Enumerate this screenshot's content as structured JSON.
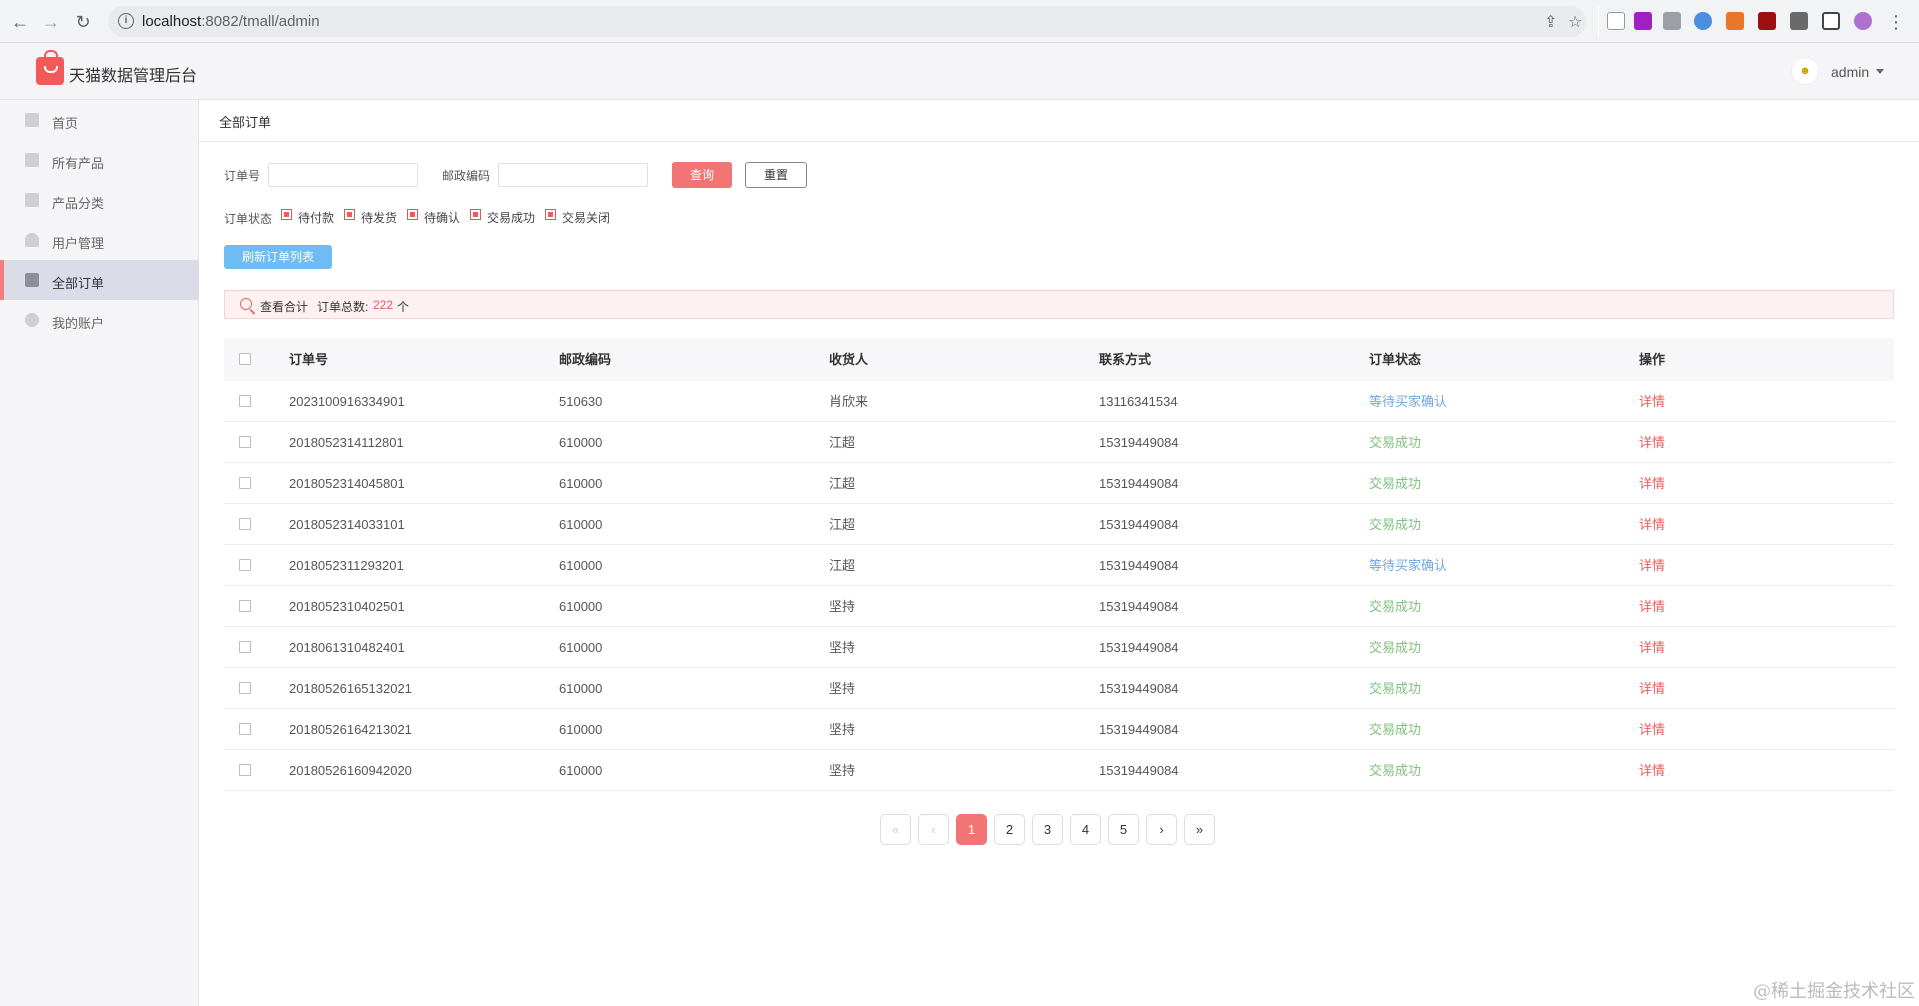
{
  "browser": {
    "back_icon": "back-arrow-icon",
    "forward_icon": "forward-arrow-icon",
    "reload_icon": "reload-icon",
    "url_host": "localhost",
    "url_path": ":8082/tmall/admin"
  },
  "header": {
    "app_title": "天猫数据管理后台",
    "admin_name": "admin"
  },
  "sidebar": {
    "items": [
      {
        "label": "首页",
        "icon": "home-icon"
      },
      {
        "label": "所有产品",
        "icon": "product-icon"
      },
      {
        "label": "产品分类",
        "icon": "category-icon"
      },
      {
        "label": "用户管理",
        "icon": "user-icon"
      },
      {
        "label": "全部订单",
        "icon": "order-icon",
        "active": true
      },
      {
        "label": "我的账户",
        "icon": "gear-icon"
      }
    ]
  },
  "main": {
    "breadcrumb": "全部订单",
    "filters": {
      "order_no_label": "订单号",
      "order_no_value": "",
      "postcode_label": "邮政编码",
      "postcode_value": "",
      "query_label": "查询",
      "reset_label": "重置",
      "status_label": "订单状态",
      "statuses": [
        "待付款",
        "待发货",
        "待确认",
        "交易成功",
        "交易关闭"
      ]
    },
    "refresh_label": "刷新订单列表",
    "summary": {
      "view_total": "查看合计",
      "total_label": "订单总数:",
      "total_count": "222",
      "unit": "个"
    },
    "table": {
      "columns": [
        "订单号",
        "邮政编码",
        "收货人",
        "联系方式",
        "订单状态",
        "操作"
      ],
      "rows": [
        {
          "order_no": "2023100916334901",
          "postcode": "510630",
          "receiver": "肖欣来",
          "phone": "13116341534",
          "status": "等待买家确认",
          "status_type": "pending",
          "action": "详情"
        },
        {
          "order_no": "2018052314112801",
          "postcode": "610000",
          "receiver": "江超",
          "phone": "15319449084",
          "status": "交易成功",
          "status_type": "success",
          "action": "详情"
        },
        {
          "order_no": "2018052314045801",
          "postcode": "610000",
          "receiver": "江超",
          "phone": "15319449084",
          "status": "交易成功",
          "status_type": "success",
          "action": "详情"
        },
        {
          "order_no": "2018052314033101",
          "postcode": "610000",
          "receiver": "江超",
          "phone": "15319449084",
          "status": "交易成功",
          "status_type": "success",
          "action": "详情"
        },
        {
          "order_no": "2018052311293201",
          "postcode": "610000",
          "receiver": "江超",
          "phone": "15319449084",
          "status": "等待买家确认",
          "status_type": "pending",
          "action": "详情"
        },
        {
          "order_no": "2018052310402501",
          "postcode": "610000",
          "receiver": "坚持",
          "phone": "15319449084",
          "status": "交易成功",
          "status_type": "success",
          "action": "详情"
        },
        {
          "order_no": "2018061310482401",
          "postcode": "610000",
          "receiver": "坚持",
          "phone": "15319449084",
          "status": "交易成功",
          "status_type": "success",
          "action": "详情"
        },
        {
          "order_no": "20180526165132021",
          "postcode": "610000",
          "receiver": "坚持",
          "phone": "15319449084",
          "status": "交易成功",
          "status_type": "success",
          "action": "详情"
        },
        {
          "order_no": "20180526164213021",
          "postcode": "610000",
          "receiver": "坚持",
          "phone": "15319449084",
          "status": "交易成功",
          "status_type": "success",
          "action": "详情"
        },
        {
          "order_no": "20180526160942020",
          "postcode": "610000",
          "receiver": "坚持",
          "phone": "15319449084",
          "status": "交易成功",
          "status_type": "success",
          "action": "详情"
        }
      ]
    },
    "pagination": {
      "first": "«",
      "prev": "‹",
      "pages": [
        "1",
        "2",
        "3",
        "4",
        "5"
      ],
      "current": "1",
      "next": "›",
      "last": "»"
    }
  },
  "watermark": "@稀土掘金技术社区",
  "colors": {
    "accent": "#f27474",
    "status_pending": "#6fa6dc",
    "status_success": "#7ec07e",
    "refresh_button": "#6fbcf2"
  }
}
